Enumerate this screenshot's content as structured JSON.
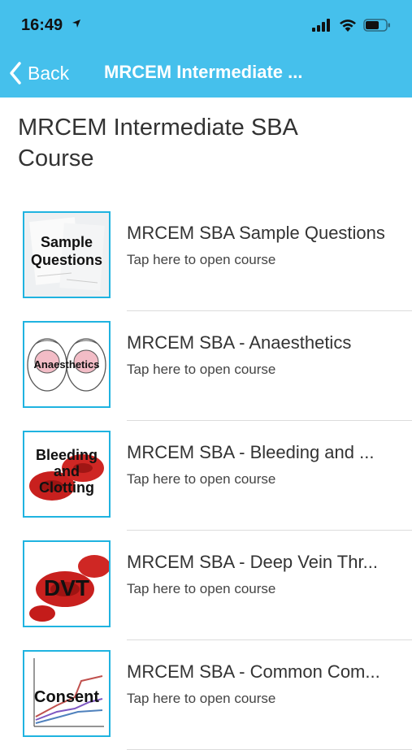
{
  "status_bar": {
    "time": "16:49"
  },
  "nav": {
    "back_label": "Back",
    "title": "MRCEM Intermediate ..."
  },
  "page": {
    "title": "MRCEM Intermediate SBA Course"
  },
  "courses": [
    {
      "title": "MRCEM SBA Sample Questions",
      "subtitle": "Tap here to open course",
      "thumb_line1": "Sample",
      "thumb_line2": "Questions"
    },
    {
      "title": "MRCEM SBA - Anaesthetics",
      "subtitle": "Tap here to open course",
      "thumb_line1": "Anaesthetics"
    },
    {
      "title": "MRCEM SBA - Bleeding and ...",
      "subtitle": "Tap here to open course",
      "thumb_line1": "Bleeding",
      "thumb_line2": "and",
      "thumb_line3": "Clotting"
    },
    {
      "title": "MRCEM SBA - Deep Vein Thr...",
      "subtitle": "Tap here to open course",
      "thumb_line1": "DVT"
    },
    {
      "title": "MRCEM SBA - Common Com...",
      "subtitle": "Tap here to open course",
      "thumb_line1": "Consent"
    }
  ],
  "colors": {
    "header": "#45c0ec",
    "thumb_border": "#1fb3e0",
    "blood_red": "#c8201e"
  },
  "icons": [
    "location-arrow-icon",
    "signal-icon",
    "wifi-icon",
    "battery-icon",
    "chevron-left-icon"
  ]
}
